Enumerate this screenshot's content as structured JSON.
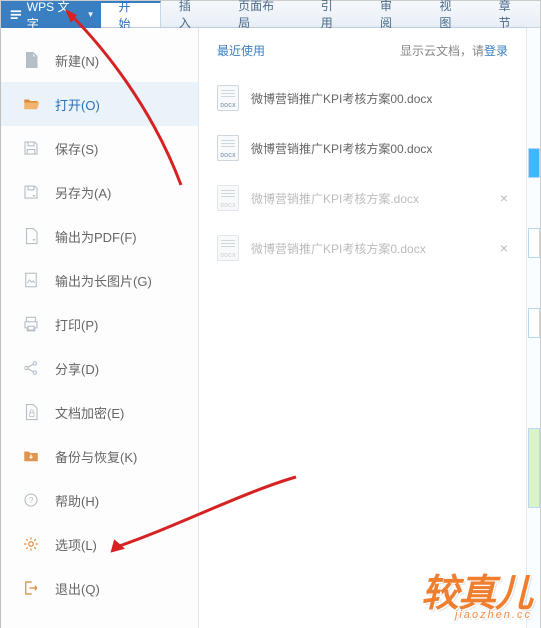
{
  "app": {
    "brand": "WPS 文字"
  },
  "tabs": [
    {
      "label": "开始",
      "active": true
    },
    {
      "label": "插入"
    },
    {
      "label": "页面布局"
    },
    {
      "label": "引用"
    },
    {
      "label": "审阅"
    },
    {
      "label": "视图"
    },
    {
      "label": "章节"
    }
  ],
  "menu": [
    {
      "key": "new",
      "label": "新建(N)"
    },
    {
      "key": "open",
      "label": "打开(O)",
      "active": true
    },
    {
      "key": "save",
      "label": "保存(S)"
    },
    {
      "key": "saveas",
      "label": "另存为(A)"
    },
    {
      "key": "exportpdf",
      "label": "输出为PDF(F)"
    },
    {
      "key": "exportimg",
      "label": "输出为长图片(G)"
    },
    {
      "key": "print",
      "label": "打印(P)"
    },
    {
      "key": "share",
      "label": "分享(D)"
    },
    {
      "key": "encrypt",
      "label": "文档加密(E)"
    },
    {
      "key": "backup",
      "label": "备份与恢复(K)"
    },
    {
      "key": "help",
      "label": "帮助(H)"
    },
    {
      "key": "options",
      "label": "选项(L)"
    },
    {
      "key": "exit",
      "label": "退出(Q)"
    }
  ],
  "recent": {
    "title": "最近使用",
    "cloud_prefix": "显示云文档，请",
    "login": "登录",
    "items": [
      {
        "name": "微博营销推广KPI考核方案00.docx",
        "dim": false
      },
      {
        "name": "微博营销推广KPI考核方案00.docx",
        "dim": false
      },
      {
        "name": "微博营销推广KPI考核方案.docx",
        "dim": true
      },
      {
        "name": "微博营销推广KPI考核方案0.docx",
        "dim": true
      }
    ]
  },
  "watermark": {
    "main": "较真儿",
    "sub": "jiaozhen.cc"
  }
}
